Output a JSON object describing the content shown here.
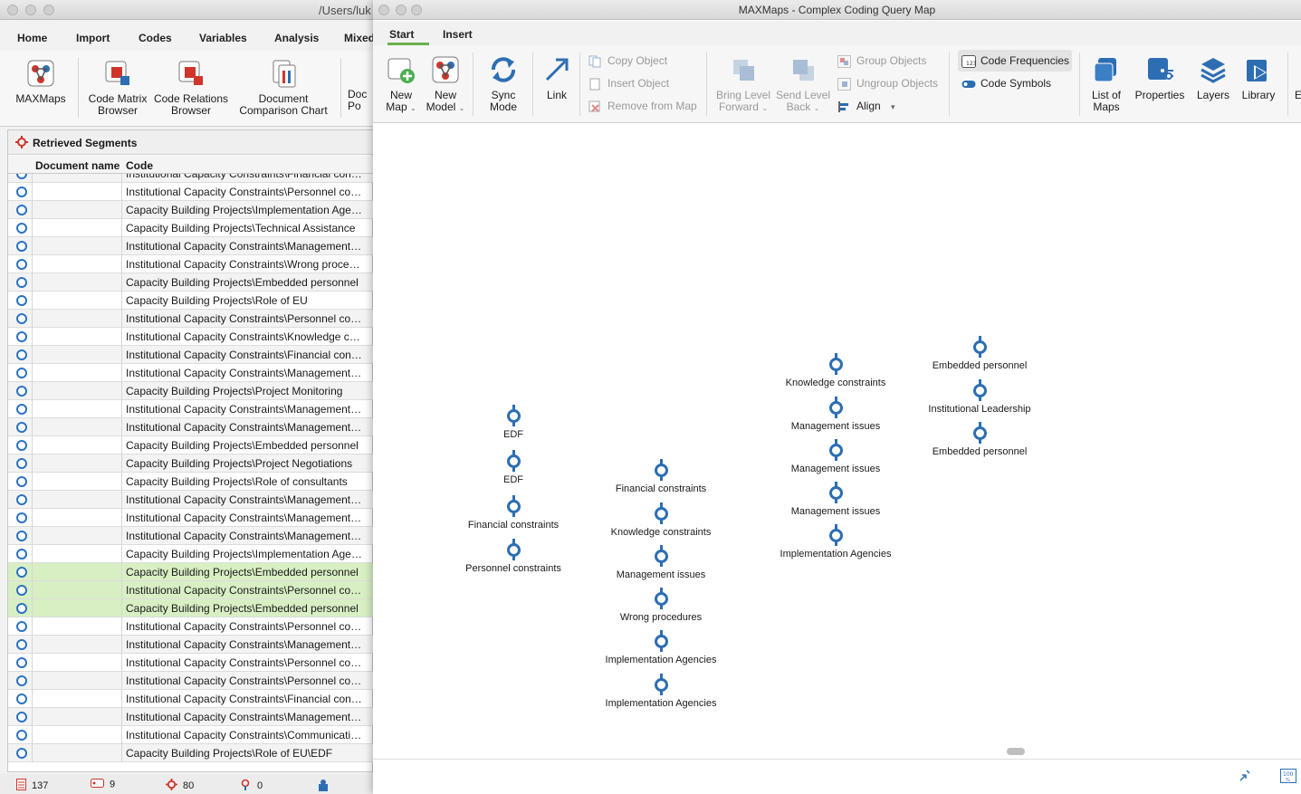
{
  "back_window": {
    "title": "/Users/luk",
    "menu": [
      "Home",
      "Import",
      "Codes",
      "Variables",
      "Analysis",
      "Mixed"
    ],
    "ribbon": {
      "maxmaps": "MAXMaps",
      "code_matrix_1": "Code Matrix",
      "code_matrix_2": "Browser",
      "code_relations_1": "Code Relations",
      "code_relations_2": "Browser",
      "doc_comparison_1": "Document",
      "doc_comparison_2": "Comparison Chart",
      "doc_po_1": "Doc",
      "doc_po_2": "Po"
    },
    "panel_title": "Retrieved Segments",
    "columns": {
      "document": "Document name",
      "code": "Code"
    },
    "rows": [
      {
        "code": "Institutional Capacity Constraints\\Financial cons...",
        "state": "alt"
      },
      {
        "code": "Institutional Capacity Constraints\\Personnel con...",
        "state": ""
      },
      {
        "code": "Capacity Building Projects\\Implementation Agen...",
        "state": "alt"
      },
      {
        "code": "Capacity Building Projects\\Technical Assistance",
        "state": ""
      },
      {
        "code": "Institutional Capacity Constraints\\Management i...",
        "state": "alt"
      },
      {
        "code": "Institutional Capacity Constraints\\Wrong proced...",
        "state": ""
      },
      {
        "code": "Capacity Building Projects\\Embedded personnel",
        "state": "alt"
      },
      {
        "code": "Capacity Building Projects\\Role of EU",
        "state": ""
      },
      {
        "code": "Institutional Capacity Constraints\\Personnel con...",
        "state": "alt"
      },
      {
        "code": "Institutional Capacity Constraints\\Knowledge co...",
        "state": ""
      },
      {
        "code": "Institutional Capacity Constraints\\Financial cons...",
        "state": "alt"
      },
      {
        "code": "Institutional Capacity Constraints\\Management i...",
        "state": ""
      },
      {
        "code": "Capacity Building Projects\\Project Monitoring",
        "state": "alt"
      },
      {
        "code": "Institutional Capacity Constraints\\Management i...",
        "state": ""
      },
      {
        "code": "Institutional Capacity Constraints\\Management i...",
        "state": "alt"
      },
      {
        "code": "Capacity Building Projects\\Embedded personnel",
        "state": ""
      },
      {
        "code": "Capacity Building Projects\\Project Negotiations",
        "state": "alt"
      },
      {
        "code": "Capacity Building Projects\\Role of consultants",
        "state": ""
      },
      {
        "code": "Institutional Capacity Constraints\\Management i...",
        "state": "alt"
      },
      {
        "code": "Institutional Capacity Constraints\\Management i...",
        "state": ""
      },
      {
        "code": "Institutional Capacity Constraints\\Management i...",
        "state": "alt"
      },
      {
        "code": "Capacity Building Projects\\Implementation Agen...",
        "state": ""
      },
      {
        "code": "Capacity Building Projects\\Embedded personnel",
        "state": "hl"
      },
      {
        "code": "Institutional Capacity Constraints\\Personnel con...",
        "state": "hl"
      },
      {
        "code": "Capacity Building Projects\\Embedded personnel",
        "state": "hl"
      },
      {
        "code": "Institutional Capacity Constraints\\Personnel con...",
        "state": ""
      },
      {
        "code": "Institutional Capacity Constraints\\Management i...",
        "state": "alt"
      },
      {
        "code": "Institutional Capacity Constraints\\Personnel con...",
        "state": ""
      },
      {
        "code": "Institutional Capacity Constraints\\Personnel con...",
        "state": "alt"
      },
      {
        "code": "Institutional Capacity Constraints\\Financial cons...",
        "state": ""
      },
      {
        "code": "Institutional Capacity Constraints\\Management i...",
        "state": "alt"
      },
      {
        "code": "Institutional Capacity Constraints\\Communicatio...",
        "state": ""
      },
      {
        "code": "Capacity Building Projects\\Role of EU\\EDF",
        "state": "alt"
      }
    ],
    "status": {
      "documents": "137",
      "codes": "9",
      "segments": "80",
      "memos": "0"
    }
  },
  "front_window": {
    "title": "MAXMaps - Complex Coding Query Map",
    "tabs": {
      "start": "Start",
      "insert": "Insert"
    },
    "ribbon": {
      "new_map_1": "New",
      "new_map_2": "Map",
      "new_model_1": "New",
      "new_model_2": "Model",
      "sync_1": "Sync",
      "sync_2": "Mode",
      "link": "Link",
      "copy_object": "Copy Object",
      "insert_object": "Insert Object",
      "remove_from_map": "Remove from Map",
      "bring_forward_1": "Bring Level",
      "bring_forward_2": "Forward",
      "send_back_1": "Send Level",
      "send_back_2": "Back",
      "group_objects": "Group Objects",
      "ungroup_objects": "Ungroup Objects",
      "align": "Align",
      "code_frequencies": "Code Frequencies",
      "code_symbols": "Code Symbols",
      "list_of_maps_1": "List of",
      "list_of_maps_2": "Maps",
      "properties": "Properties",
      "layers": "Layers",
      "library": "Library",
      "overflow": "E"
    },
    "nodes": {
      "col1": [
        "EDF",
        "EDF",
        "Financial constraints",
        "Personnel constraints"
      ],
      "col2": [
        "Financial constraints",
        "Knowledge constraints",
        "Management issues",
        "Wrong procedures",
        "Implementation Agencies",
        "Implementation Agencies"
      ],
      "col3": [
        "Knowledge constraints",
        "Management issues",
        "Management issues",
        "Management issues",
        "Implementation Agencies"
      ],
      "col4": [
        "Embedded personnel",
        "Institutional Leadership",
        "Embedded personnel"
      ]
    }
  },
  "colors": {
    "accent_blue": "#2d6eb3",
    "tab_green": "#6ab04c",
    "highlight_green": "#d8efc4",
    "status_red": "#d0352b"
  }
}
